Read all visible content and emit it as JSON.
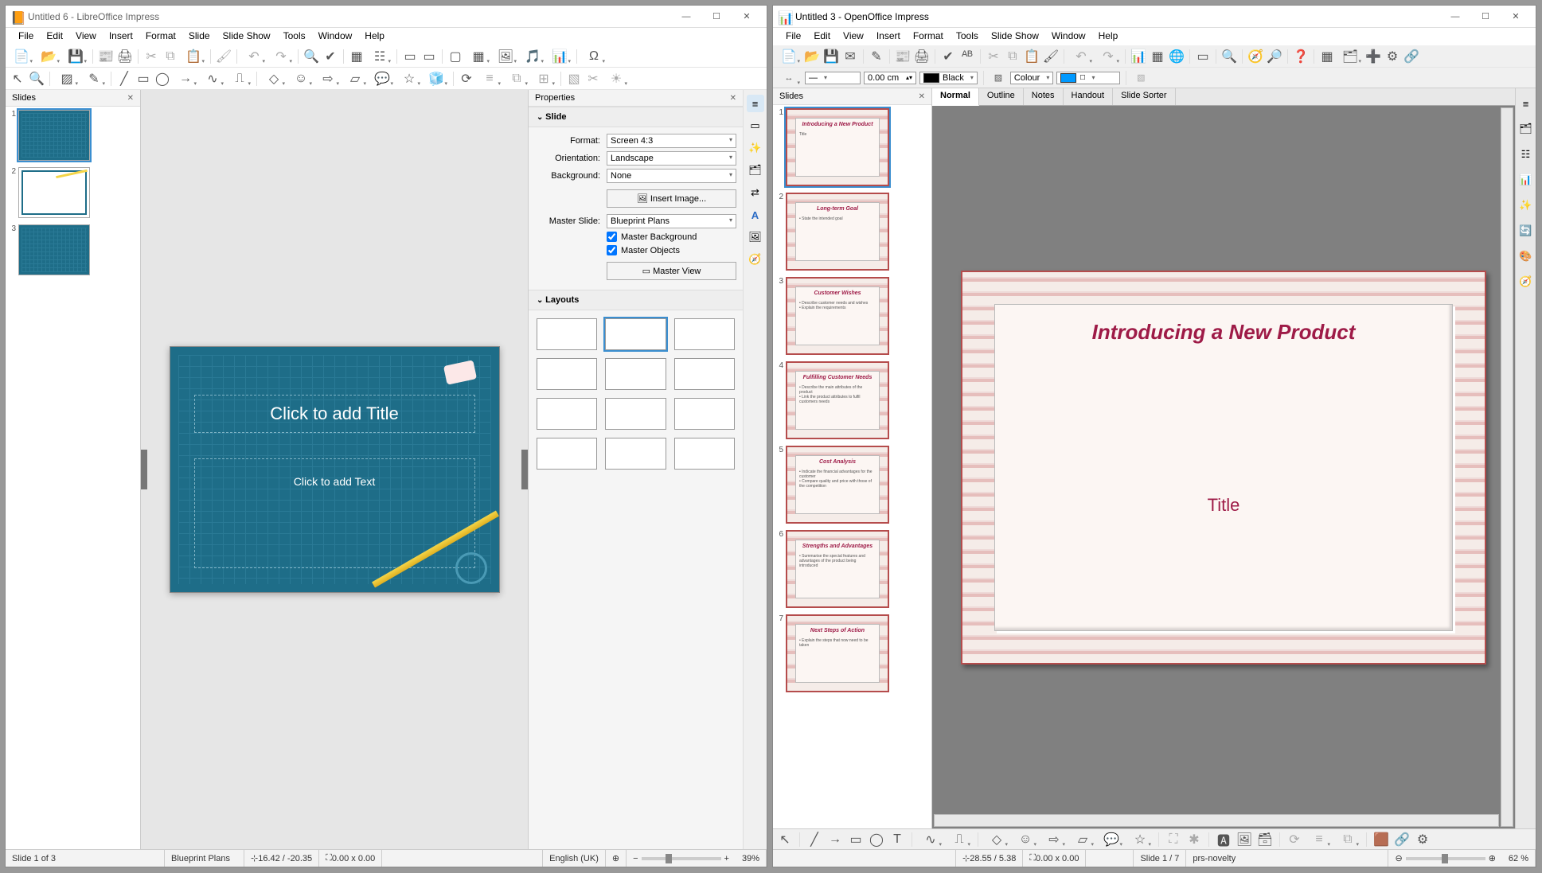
{
  "libre": {
    "title": "Untitled 6 - LibreOffice Impress",
    "menus": [
      "File",
      "Edit",
      "View",
      "Insert",
      "Format",
      "Slide",
      "Slide Show",
      "Tools",
      "Window",
      "Help"
    ],
    "slides_panel_title": "Slides",
    "slide_title_placeholder": "Click to add Title",
    "slide_text_placeholder": "Click to add Text",
    "properties": {
      "panel_title": "Properties",
      "section_slide": "Slide",
      "format_label": "Format:",
      "format_value": "Screen 4:3",
      "orientation_label": "Orientation:",
      "orientation_value": "Landscape",
      "background_label": "Background:",
      "background_value": "None",
      "insert_image_btn": "Insert Image...",
      "master_slide_label": "Master Slide:",
      "master_slide_value": "Blueprint Plans",
      "master_bg_chk": "Master Background",
      "master_obj_chk": "Master Objects",
      "master_view_btn": "Master View",
      "section_layouts": "Layouts"
    },
    "status": {
      "slide": "Slide 1 of 3",
      "master": "Blueprint Plans",
      "coords": "16.42 / -20.35",
      "size": "0.00 x 0.00",
      "lang": "English (UK)",
      "zoom": "39%"
    }
  },
  "oo": {
    "title": "Untitled 3 - OpenOffice Impress",
    "menus": [
      "File",
      "Edit",
      "View",
      "Insert",
      "Format",
      "Tools",
      "Slide Show",
      "Window",
      "Help"
    ],
    "slides_panel_title": "Slides",
    "line_width": "0.00 cm",
    "line_color_label": "Black",
    "fill_label": "Colour",
    "view_tabs": [
      "Normal",
      "Outline",
      "Notes",
      "Handout",
      "Slide Sorter"
    ],
    "main_title": "Introducing a New Product",
    "main_subtitle": "Title",
    "thumbs": [
      {
        "title": "Introducing a New Product",
        "sub": "Title"
      },
      {
        "title": "Long-term Goal",
        "sub": "• State the intended goal"
      },
      {
        "title": "Customer Wishes",
        "sub": "• Describe customer needs and wishes\n• Explain the requirements"
      },
      {
        "title": "Fulfilling Customer Needs",
        "sub": "• Describe the main attributes of the product\n• Link the product attributes to fulfil customers needs"
      },
      {
        "title": "Cost Analysis",
        "sub": "• Indicate the financial advantages for the customer\n• Compare quality and price with those of the competition"
      },
      {
        "title": "Strengths and Advantages",
        "sub": "• Summarise the special features and advantages of the product being introduced"
      },
      {
        "title": "Next Steps of Action",
        "sub": "• Explain the steps that now need to be taken"
      }
    ],
    "status": {
      "coords": "28.55 / 5.38",
      "size": "0.00 x 0.00",
      "slide": "Slide 1 / 7",
      "master": "prs-novelty",
      "zoom": "62 %"
    }
  }
}
